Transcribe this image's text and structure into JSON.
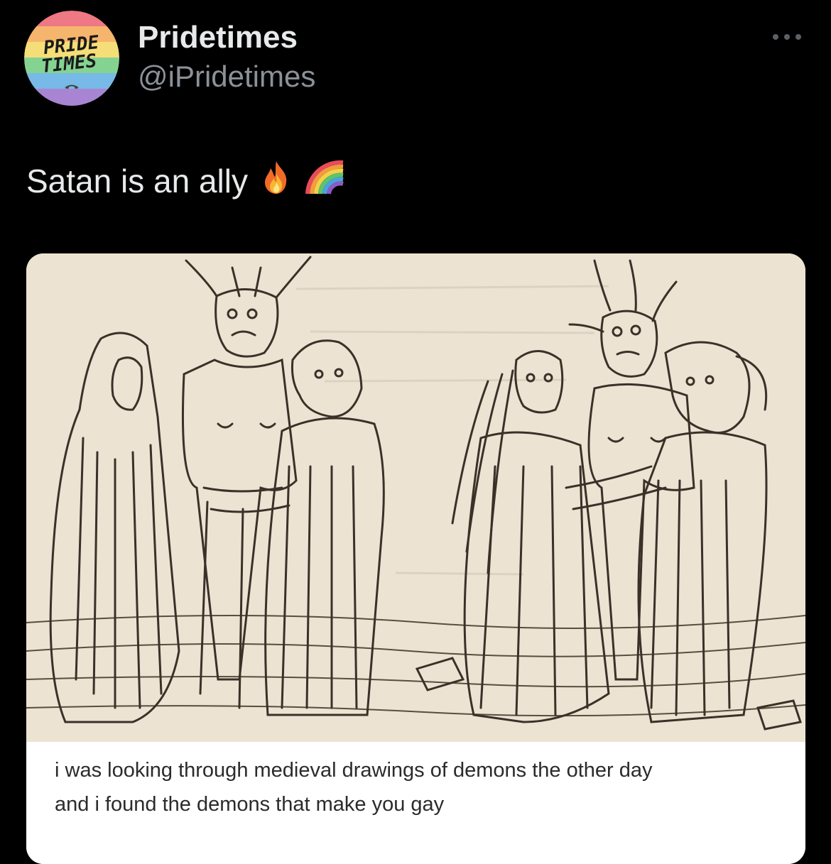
{
  "header": {
    "display_name": "Pridetimes",
    "handle": "@iPridetimes",
    "avatar": {
      "line1": "PRIDE",
      "line2": "TIMES",
      "colors": [
        "#e94b5a",
        "#f39c3d",
        "#f2d24a",
        "#5cc46d",
        "#4aa3df",
        "#8b5cc4"
      ]
    },
    "more_icon": "ellipsis-icon"
  },
  "tweet": {
    "text": "Satan is an ally",
    "emojis": [
      "fire-emoji",
      "rainbow-emoji"
    ]
  },
  "media": {
    "caption_line1": "i was looking through medieval drawings of demons the other day",
    "caption_line2": "and i found the demons that make you gay"
  },
  "colors": {
    "background": "#000000",
    "primary_text": "#e7e9ea",
    "secondary_text": "#8b9199",
    "parchment": "#ede3d3",
    "ink": "#3a3128"
  }
}
